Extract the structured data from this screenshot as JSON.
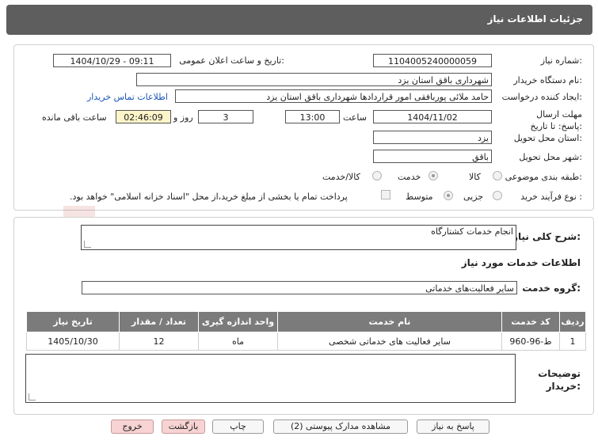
{
  "header": {
    "title": "جزئیات اطلاعات نیاز"
  },
  "form": {
    "need_number_label": "شماره نیاز:",
    "need_number": "1104005240000059",
    "announce_label": "تاریخ و ساعت اعلان عمومی:",
    "announce_value": "1404/10/29 - 09:11",
    "buyer_org_label": "نام دستگاه خریدار:",
    "buyer_org": "شهرداری باقق استان یزد",
    "creator_label": "ایجاد کننده درخواست:",
    "creator": "حامد ملائی پوربافقی امور قراردادها شهرداری باقق استان یزد",
    "contact_link": "اطلاعات تماس خریدار",
    "deadline_label": "مهلت ارسال پاسخ: تا تاریخ:",
    "deadline_date": "1404/11/02",
    "time_label": "ساعت",
    "deadline_time": "13:00",
    "days": "3",
    "days_label": "روز و",
    "remaining": "02:46:09",
    "remaining_label": "ساعت باقی مانده",
    "province_label": "استان محل تحویل:",
    "province": "یزد",
    "city_label": "شهر محل تحویل:",
    "city": "باقق",
    "category_label": "طبقه بندی موضوعی:",
    "category_options": [
      "کالا",
      "خدمت",
      "کالا/خدمت"
    ],
    "category_selected": "خدمت",
    "process_label": "نوع فرآیند خرید :",
    "process_options": [
      "جزیی",
      "متوسط"
    ],
    "process_selected": "متوسط",
    "payment_note": "پرداخت تمام یا بخشی از مبلغ خرید،از محل \"اسناد خزانه اسلامی\" خواهد بود."
  },
  "summary": {
    "label": "شرح کلی نیاز:",
    "value": "انجام خدمات کشتارگاه"
  },
  "services": {
    "section_title": "اطلاعات خدمات مورد نیاز",
    "group_label": "گروه خدمت:",
    "group_value": "سایر فعالیت‌های خدماتی",
    "columns": [
      "ردیف",
      "کد خدمت",
      "نام خدمت",
      "واحد اندازه گیری",
      "تعداد / مقدار",
      "تاریخ نیاز"
    ],
    "rows": [
      [
        "1",
        "ط-96-960",
        "سایر فعالیت های خدماتی شخصی",
        "ماه",
        "12",
        "1405/10/30"
      ]
    ]
  },
  "notes": {
    "label": "توضیحات خریدار:",
    "value": ""
  },
  "buttons": {
    "reply": "پاسخ به نیاز",
    "attachments": "مشاهده مدارک پیوستی (2)",
    "print": "چاپ",
    "back": "بازگشت",
    "exit": "خروج"
  },
  "watermark": "AriaTender.neT",
  "colors": {
    "title_bar": "#5e5e5e",
    "table_header": "#7b7b7b",
    "link": "#1a56b8",
    "danger_button": "#f7d3d3",
    "remaining_bg": "#fdf5c9"
  }
}
